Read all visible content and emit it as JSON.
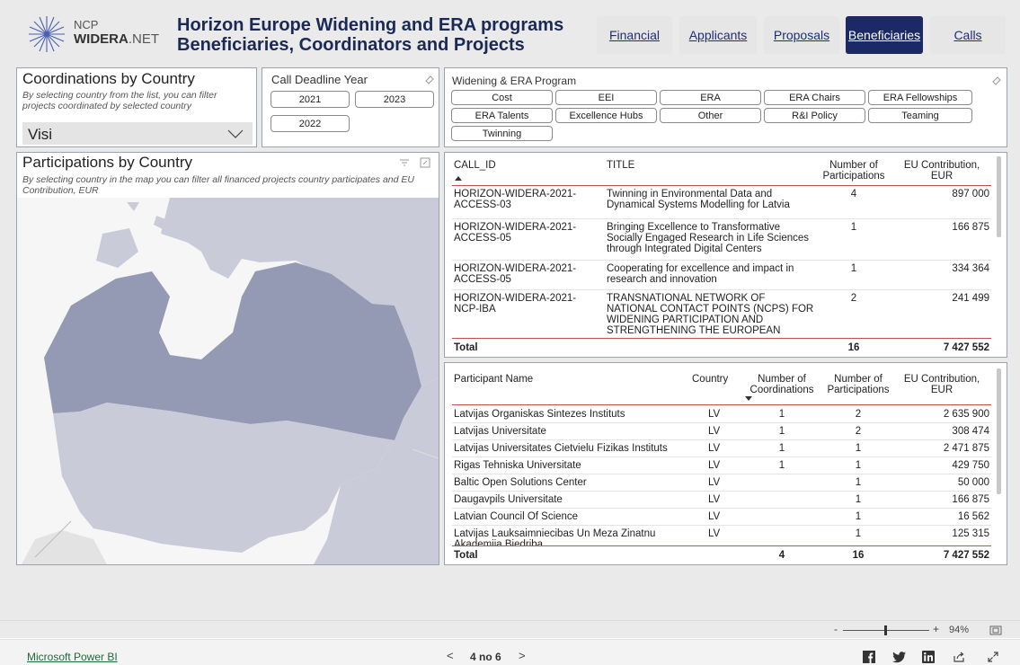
{
  "logo": {
    "line1": "NCP",
    "line2_bold": "WIDERA",
    "line2_rest": ".NET"
  },
  "header": {
    "title_line1": "Horizon Europe Widening and ERA programs",
    "title_line2": "Beneficiaries, Coordinators and Projects"
  },
  "nav": {
    "tabs": [
      "Financial",
      "Applicants",
      "Proposals",
      "Beneficiaries",
      "Calls"
    ],
    "active": "Beneficiaries"
  },
  "coord_panel": {
    "title": "Coordinations by Country",
    "subtitle": "By selecting country from the list, you can filter projects coordinated by selected country",
    "dropdown_value": "Visi"
  },
  "deadline_panel": {
    "title": "Call Deadline Year",
    "options": [
      "2021",
      "2023",
      "2022"
    ]
  },
  "program_panel": {
    "title": "Widening & ERA Program",
    "options": [
      "Cost",
      "EEI",
      "ERA",
      "ERA Chairs",
      "ERA Fellowships",
      "ERA Talents",
      "Excellence Hubs",
      "Other",
      "R&I Policy",
      "Teaming",
      "Twinning"
    ]
  },
  "map_panel": {
    "title": "Participations by Country",
    "subtitle": "By selecting country in the map you can filter all financed projects country participates and EU Contribution, EUR"
  },
  "calls_table": {
    "headers": {
      "call_id": "CALL_ID",
      "title": "TITLE",
      "participations": "Number of Participations",
      "contribution": "EU Contribution, EUR"
    },
    "rows": [
      {
        "call_id": "HORIZON-WIDERA-2021-ACCESS-03",
        "title": "Twinning in Environmental Data and Dynamical Systems Modelling for Latvia",
        "participations": "4",
        "contribution": "897 000"
      },
      {
        "call_id": "HORIZON-WIDERA-2021-ACCESS-05",
        "title": "Bringing Excellence to Transformative Socially Engaged Research in Life Sciences through Integrated Digital Centers",
        "participations": "1",
        "contribution": "166 875"
      },
      {
        "call_id": "HORIZON-WIDERA-2021-ACCESS-05",
        "title": "Cooperating for excellence and impact in research and innovation",
        "participations": "1",
        "contribution": "334 364"
      },
      {
        "call_id": "HORIZON-WIDERA-2021-NCP-IBA",
        "title": "TRANSNATIONAL NETWORK OF NATIONAL CONTACT POINTS (NCPS) FOR WIDENING PARTICIPATION AND STRENGTHENING THE EUROPEAN",
        "participations": "2",
        "contribution": "241 499"
      }
    ],
    "total": {
      "label": "Total",
      "participations": "16",
      "contribution": "7 427 552"
    }
  },
  "participants_table": {
    "headers": {
      "name": "Participant Name",
      "country": "Country",
      "coordinations": "Number of Coordinations",
      "participations": "Number of Participations",
      "contribution": "EU Contribution, EUR"
    },
    "rows": [
      {
        "name": "Latvijas Organiskas Sintezes Instituts",
        "country": "LV",
        "coordinations": "1",
        "participations": "2",
        "contribution": "2 635 900"
      },
      {
        "name": "Latvijas Universitate",
        "country": "LV",
        "coordinations": "1",
        "participations": "2",
        "contribution": "308 474"
      },
      {
        "name": "Latvijas Universitates Cietvielu Fizikas Instituts",
        "country": "LV",
        "coordinations": "1",
        "participations": "1",
        "contribution": "2 471 875"
      },
      {
        "name": "Rigas Tehniska Universitate",
        "country": "LV",
        "coordinations": "1",
        "participations": "1",
        "contribution": "429 750"
      },
      {
        "name": "Baltic Open Solutions Center",
        "country": "LV",
        "coordinations": "",
        "participations": "1",
        "contribution": "50 000"
      },
      {
        "name": "Daugavpils Universitate",
        "country": "LV",
        "coordinations": "",
        "participations": "1",
        "contribution": "166 875"
      },
      {
        "name": "Latvian Council Of Science",
        "country": "LV",
        "coordinations": "",
        "participations": "1",
        "contribution": "16 562"
      },
      {
        "name": "Latvijas Lauksaimniecibas Un Meza Zinatnu Akademija Biedriba",
        "country": "LV",
        "coordinations": "",
        "participations": "1",
        "contribution": "125 315"
      }
    ],
    "total": {
      "label": "Total",
      "coordinations": "4",
      "participations": "16",
      "contribution": "7 427 552"
    }
  },
  "zoom": {
    "minus": "-",
    "plus": "+",
    "level": "94%"
  },
  "footer": {
    "brand": "Microsoft Power BI",
    "page_prev": "<",
    "page_label": "4 no 6",
    "page_next": ">"
  },
  "colors": {
    "nav_active": "#1b2a66",
    "map_selected": "#9499b4",
    "map_other": "#c9ccd8",
    "total_line": "#c0504d",
    "link": "#1f6a3f"
  },
  "icons": [
    "snowflake-logo-icon",
    "eraser-icon",
    "chevron-down-icon",
    "filter-icon",
    "focus-mode-icon",
    "sort-asc-icon",
    "sort-desc-icon",
    "fit-page-icon",
    "facebook-icon",
    "twitter-icon",
    "linkedin-icon",
    "share-icon",
    "fullscreen-icon"
  ]
}
